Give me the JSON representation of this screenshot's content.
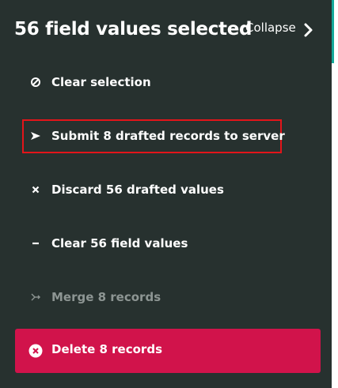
{
  "header": {
    "title": "56 field values selected",
    "collapse_label": "Collapse"
  },
  "actions": [
    {
      "label": "Clear selection",
      "icon": "cancel-icon",
      "enabled": true
    },
    {
      "label": "Submit 8 drafted records to server",
      "icon": "send-icon",
      "enabled": true
    },
    {
      "label": "Discard 56 drafted values",
      "icon": "x-icon",
      "enabled": true
    },
    {
      "label": "Clear 56 field values",
      "icon": "minus-icon",
      "enabled": true
    },
    {
      "label": "Merge 8 records",
      "icon": "merge-icon",
      "enabled": false
    }
  ],
  "delete_action": {
    "label": "Delete 8 records",
    "icon": "x-circle-icon"
  },
  "colors": {
    "panel_bg": "#27312f",
    "delete_bg": "#d1134b",
    "highlight_border": "#e3151a",
    "disabled_text": "#8d9593"
  }
}
